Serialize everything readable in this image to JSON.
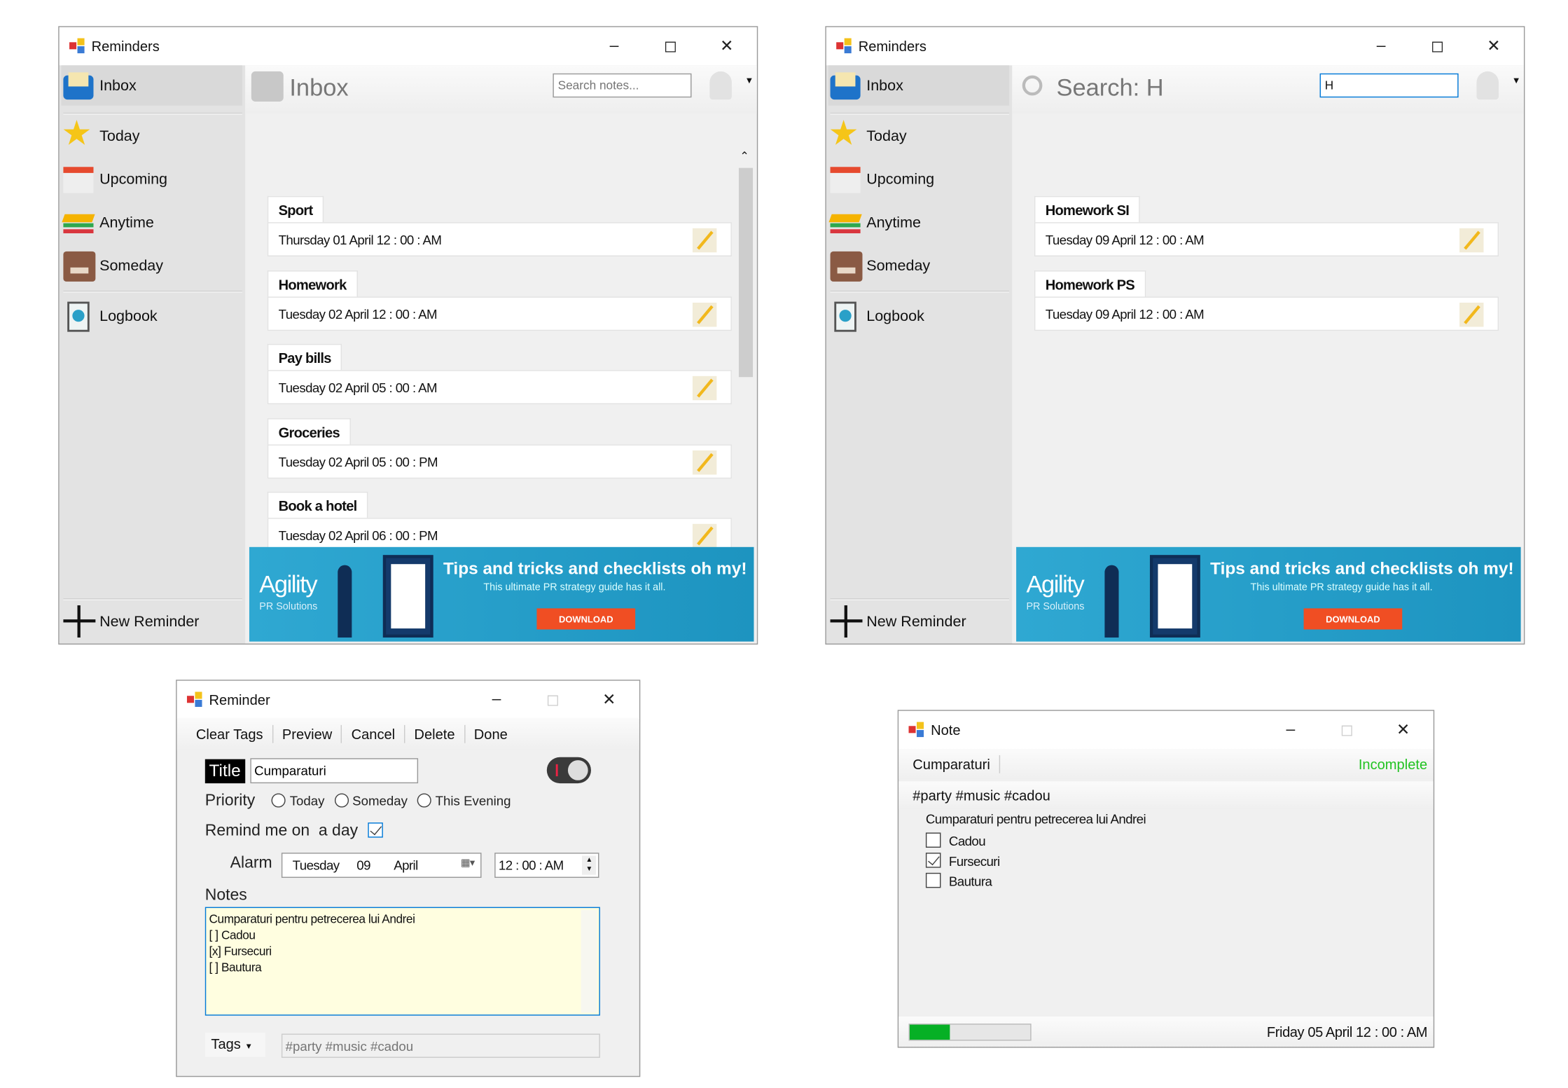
{
  "colors": {
    "accent": "#0078d7",
    "ad_bg": "#1d94c0",
    "download": "#f04e23",
    "status_green": "#22c322",
    "progress": "#06b025"
  },
  "inbox_window": {
    "title": "Reminders",
    "header_title": "Inbox",
    "search_placeholder": "Search notes...",
    "sidebar": {
      "items": [
        {
          "label": "Inbox",
          "icon": "inbox-icon"
        },
        {
          "label": "Today",
          "icon": "star-icon"
        },
        {
          "label": "Upcoming",
          "icon": "calendar-icon"
        },
        {
          "label": "Anytime",
          "icon": "layers-icon"
        },
        {
          "label": "Someday",
          "icon": "archive-box-icon"
        },
        {
          "label": "Logbook",
          "icon": "logbook-icon"
        }
      ],
      "new_reminder": "New Reminder"
    },
    "reminders": [
      {
        "title": "Sport",
        "date": "Thursday 01 April 12 : 00 : AM"
      },
      {
        "title": "Homework",
        "date": "Tuesday 02 April 12 : 00 : AM"
      },
      {
        "title": "Pay bills",
        "date": "Tuesday 02 April 05 : 00 : AM"
      },
      {
        "title": "Groceries",
        "date": "Tuesday 02 April 05 : 00 : PM"
      },
      {
        "title": "Book a hotel",
        "date": "Tuesday 02 April 06 : 00 : PM"
      }
    ]
  },
  "search_window": {
    "title": "Reminders",
    "header_title": "Search: H",
    "search_value": "H",
    "sidebar": {
      "items": [
        {
          "label": "Inbox",
          "icon": "inbox-icon"
        },
        {
          "label": "Today",
          "icon": "star-icon"
        },
        {
          "label": "Upcoming",
          "icon": "calendar-icon"
        },
        {
          "label": "Anytime",
          "icon": "layers-icon"
        },
        {
          "label": "Someday",
          "icon": "archive-box-icon"
        },
        {
          "label": "Logbook",
          "icon": "logbook-icon"
        }
      ],
      "new_reminder": "New Reminder"
    },
    "reminders": [
      {
        "title": "Homework SI",
        "date": "Tuesday 09 April 12 : 00 : AM"
      },
      {
        "title": "Homework PS",
        "date": "Tuesday 09 April 12 : 00 : AM"
      }
    ]
  },
  "ad": {
    "brand": "Agility",
    "brand_sub": "PR Solutions",
    "headline": "Tips and tricks and checklists oh my!",
    "tagline": "This ultimate PR strategy guide has it all.",
    "button": "DOWNLOAD"
  },
  "reminder_window": {
    "title": "Reminder",
    "toolbar": [
      "Clear Tags",
      "Preview",
      "Cancel",
      "Delete",
      "Done"
    ],
    "title_label": "Title",
    "title_value": "Cumparaturi",
    "priority_label": "Priority",
    "priority_options": [
      "Today",
      "Someday",
      "This Evening"
    ],
    "remind_label": "Remind me on  a day",
    "remind_checked": true,
    "alarm_label": "Alarm",
    "alarm_day": "Tuesday",
    "alarm_date": "09",
    "alarm_month": "April",
    "alarm_time": "12 : 00 : AM",
    "notes_label": "Notes",
    "notes_lines": [
      "Cumparaturi pentru petrecerea lui Andrei",
      "[ ] Cadou",
      "[x] Fursecuri",
      "[ ] Bautura"
    ],
    "tags_label": "Tags",
    "tags_placeholder": "#party #music #cadou"
  },
  "note_window": {
    "title": "Note",
    "note_title": "Cumparaturi",
    "status": "Incomplete",
    "tags": "#party #music #cadou",
    "description": "Cumparaturi pentru petrecerea lui Andrei",
    "items": [
      {
        "label": "Cadou",
        "checked": false
      },
      {
        "label": "Fursecuri",
        "checked": true
      },
      {
        "label": "Bautura",
        "checked": false
      }
    ],
    "progress": 0.33,
    "date": "Friday 05 April 12 : 00 : AM"
  }
}
